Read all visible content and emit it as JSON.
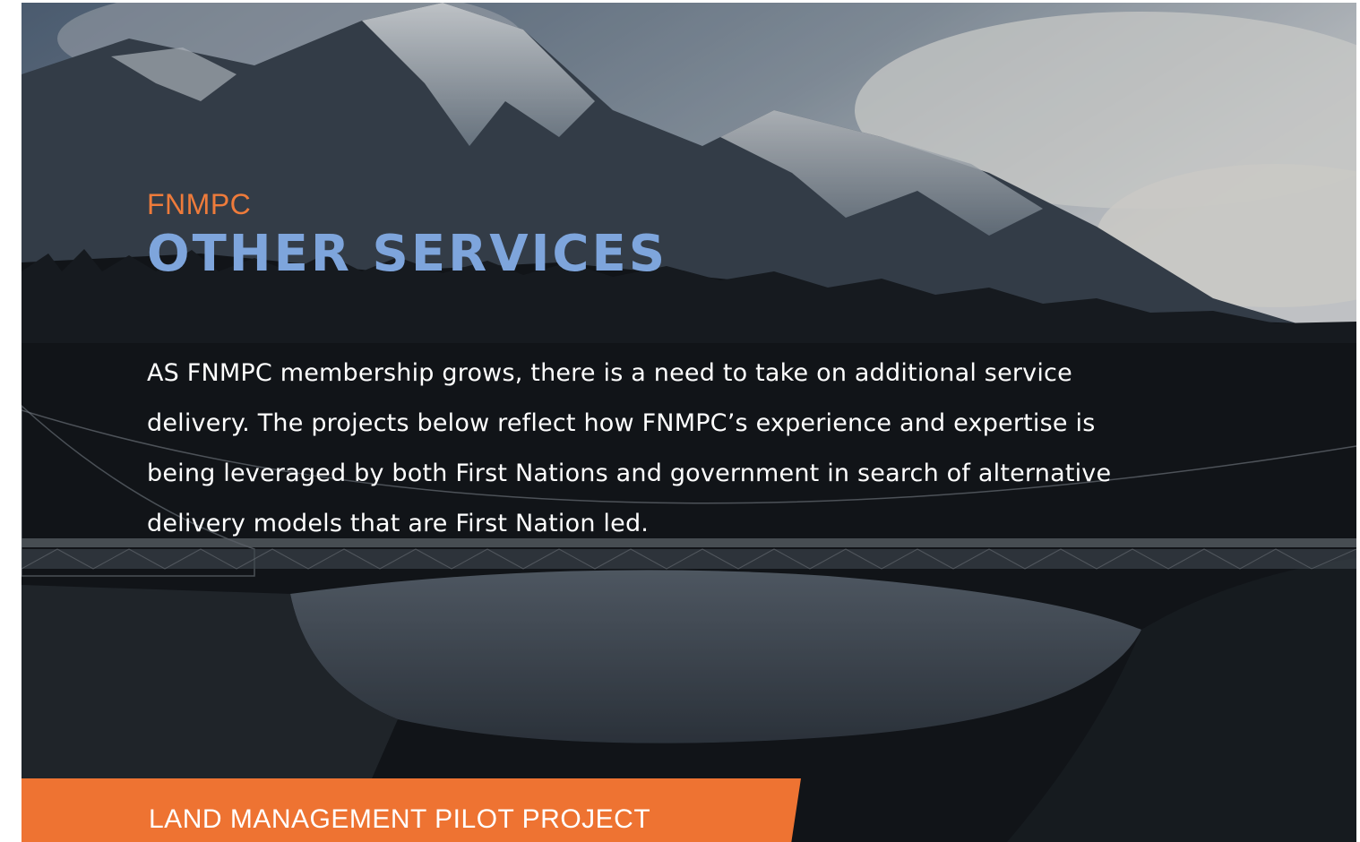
{
  "hero": {
    "background_image": "mountain-bridge-landscape",
    "eyebrow": "FNMPC",
    "title": "OTHER SERVICES",
    "intro": "AS FNMPC membership grows, there is a need to take on additional service delivery. The projects below reflect how FNMPC’s experience and expertise is being leveraged by both First Nations and government in search of alternative delivery models that are First Nation led."
  },
  "section_tab": {
    "label": "LAND MANAGEMENT PILOT PROJECT"
  },
  "colors": {
    "accent_orange": "#ee7332",
    "title_blue": "#7ea5dc",
    "body_text": "#ffffff"
  }
}
